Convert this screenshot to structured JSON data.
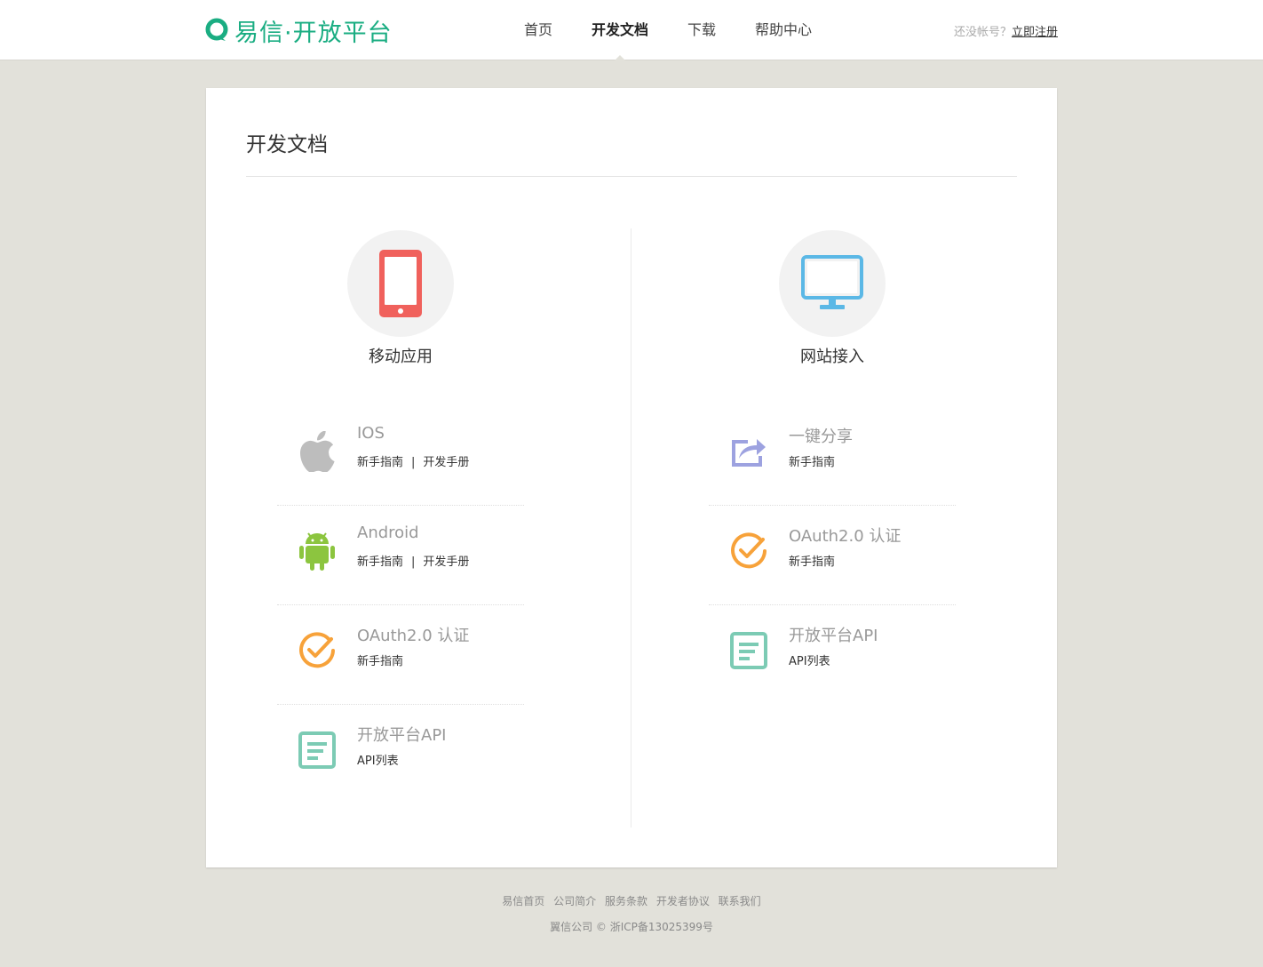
{
  "header": {
    "logo_text": "易信·开放平台",
    "nav": [
      {
        "label": "首页",
        "active": false
      },
      {
        "label": "开发文档",
        "active": true
      },
      {
        "label": "下载",
        "active": false
      },
      {
        "label": "帮助中心",
        "active": false
      }
    ],
    "signup_prompt": "还没帐号？",
    "signup_link": "立即注册"
  },
  "main": {
    "title": "开发文档",
    "columns": [
      {
        "label": "移动应用",
        "icon": "phone-icon",
        "items": [
          {
            "name": "IOS",
            "icon": "apple-icon",
            "links": [
              "新手指南",
              "开发手册"
            ]
          },
          {
            "name": "Android",
            "icon": "android-icon",
            "links": [
              "新手指南",
              "开发手册"
            ]
          },
          {
            "name": "OAuth2.0 认证",
            "icon": "oauth-check-icon",
            "links": [
              "新手指南"
            ]
          },
          {
            "name": "开放平台API",
            "icon": "api-document-icon",
            "links": [
              "API列表"
            ]
          }
        ]
      },
      {
        "label": "网站接入",
        "icon": "monitor-icon",
        "items": [
          {
            "name": "一键分享",
            "icon": "share-icon",
            "links": [
              "新手指南"
            ]
          },
          {
            "name": "OAuth2.0 认证",
            "icon": "oauth-check-icon",
            "links": [
              "新手指南"
            ]
          },
          {
            "name": "开放平台API",
            "icon": "api-document-icon",
            "links": [
              "API列表"
            ]
          }
        ]
      }
    ]
  },
  "footer": {
    "links": [
      "易信首页",
      "公司简介",
      "服务条款",
      "开发者协议",
      "联系我们"
    ],
    "copyright": "翼信公司 © 浙ICP备13025399号"
  },
  "colors": {
    "brand": "#1aad82",
    "background": "#e2e1da",
    "phone": "#f0615c",
    "monitor": "#5bb8e6",
    "apple": "#bdbdbd",
    "android": "#8cc53f",
    "oauth": "#f7a23a",
    "api": "#7ccbb4",
    "share": "#9da2e0"
  }
}
